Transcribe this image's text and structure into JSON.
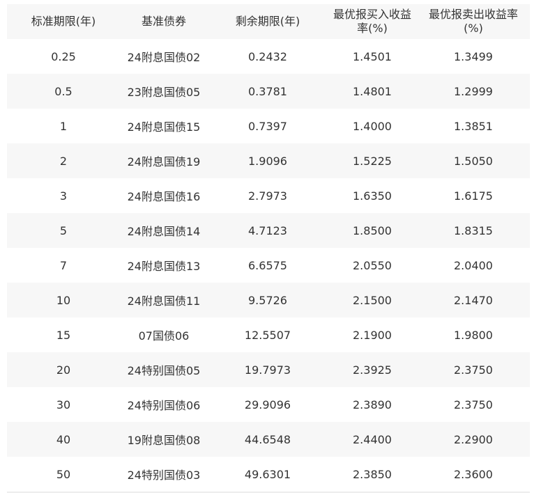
{
  "headers": [
    "标准期限(年)",
    "基准债券",
    "剩余期限(年)",
    "最优报买入收益率(%)",
    "最优报卖出收益率(%)"
  ],
  "rows": [
    [
      "0.25",
      "24附息国债02",
      "0.2432",
      "1.4501",
      "1.3499"
    ],
    [
      "0.5",
      "23附息国债05",
      "0.3781",
      "1.4801",
      "1.2999"
    ],
    [
      "1",
      "24附息国债15",
      "0.7397",
      "1.4000",
      "1.3851"
    ],
    [
      "2",
      "24附息国债19",
      "1.9096",
      "1.5225",
      "1.5050"
    ],
    [
      "3",
      "24附息国债16",
      "2.7973",
      "1.6350",
      "1.6175"
    ],
    [
      "5",
      "24附息国债14",
      "4.7123",
      "1.8500",
      "1.8315"
    ],
    [
      "7",
      "24附息国债13",
      "6.6575",
      "2.0550",
      "2.0400"
    ],
    [
      "10",
      "24附息国债11",
      "9.5726",
      "2.1500",
      "2.1470"
    ],
    [
      "15",
      "07国债06",
      "12.5507",
      "2.1900",
      "1.9800"
    ],
    [
      "20",
      "24特别国债05",
      "19.7973",
      "2.3925",
      "2.3750"
    ],
    [
      "30",
      "24特别国债06",
      "29.9096",
      "2.3890",
      "2.3750"
    ],
    [
      "40",
      "19附息国债08",
      "44.6548",
      "2.4400",
      "2.2900"
    ],
    [
      "50",
      "24特别国债03",
      "49.6301",
      "2.3850",
      "2.3600"
    ]
  ]
}
